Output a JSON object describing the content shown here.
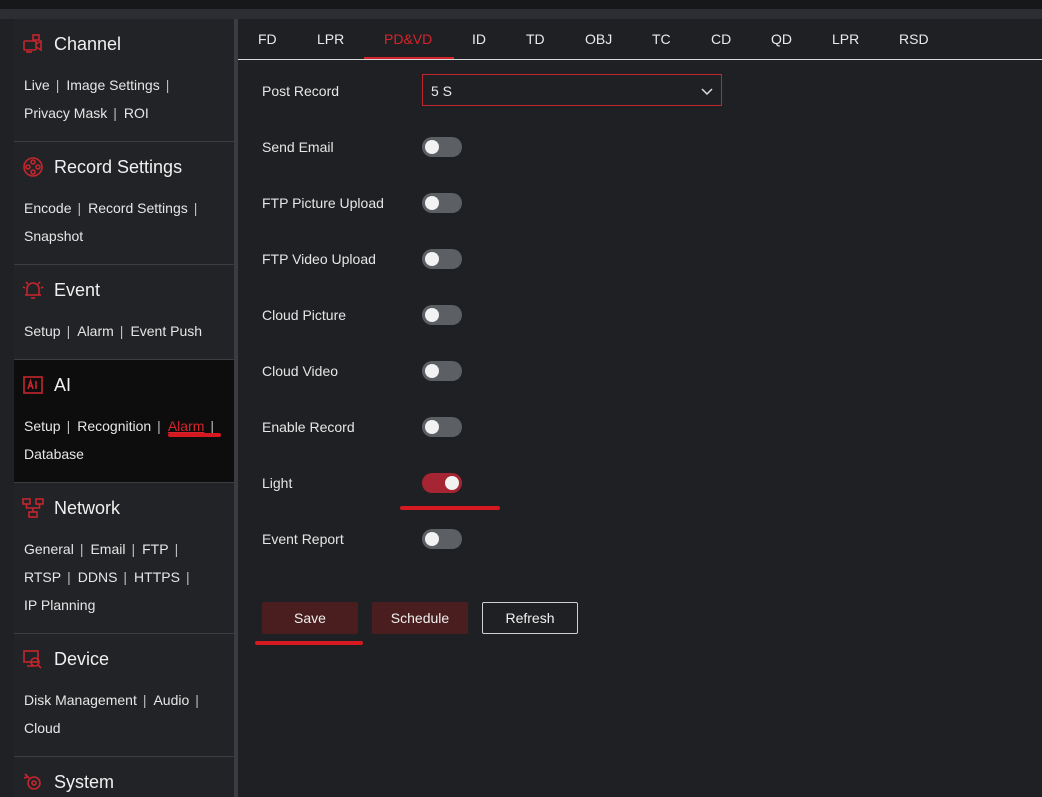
{
  "sidebar": {
    "sections": [
      {
        "title": "Channel",
        "icon": "camera-icon",
        "links": [
          "Live",
          "Image Settings",
          "Privacy Mask",
          "ROI"
        ]
      },
      {
        "title": "Record Settings",
        "icon": "film-reel-icon",
        "links": [
          "Encode",
          "Record Settings",
          "Snapshot"
        ]
      },
      {
        "title": "Event",
        "icon": "alarm-bell-icon",
        "links": [
          "Setup",
          "Alarm",
          "Event Push"
        ]
      },
      {
        "title": "AI",
        "icon": "ai-icon",
        "links": [
          "Setup",
          "Recognition",
          "Alarm",
          "Database"
        ],
        "selected_link": "Alarm"
      },
      {
        "title": "Network",
        "icon": "network-icon",
        "links": [
          "General",
          "Email",
          "FTP",
          "RTSP",
          "DDNS",
          "HTTPS",
          "IP Planning"
        ]
      },
      {
        "title": "Device",
        "icon": "device-icon",
        "links": [
          "Disk Management",
          "Audio",
          "Cloud"
        ]
      },
      {
        "title": "System",
        "icon": "system-gear-icon",
        "links": []
      }
    ]
  },
  "tabs": {
    "items": [
      "FD",
      "LPR",
      "PD&VD",
      "ID",
      "TD",
      "OBJ",
      "TC",
      "CD",
      "QD",
      "LPR",
      "RSD"
    ],
    "selected": "PD&VD"
  },
  "form": {
    "post_record": {
      "label": "Post Record",
      "value": "5 S"
    },
    "toggles": [
      {
        "label": "Send Email",
        "on": false
      },
      {
        "label": "FTP Picture Upload",
        "on": false
      },
      {
        "label": "FTP Video Upload",
        "on": false
      },
      {
        "label": "Cloud Picture",
        "on": false
      },
      {
        "label": "Cloud Video",
        "on": false
      },
      {
        "label": "Enable Record",
        "on": false
      },
      {
        "label": "Light",
        "on": true
      },
      {
        "label": "Event Report",
        "on": false
      }
    ]
  },
  "buttons": {
    "save": "Save",
    "schedule": "Schedule",
    "refresh": "Refresh"
  },
  "colors": {
    "accent": "#d4252c",
    "toggle_on": "#a52532",
    "toggle_off": "#5c5f64",
    "button_fill": "#4a1e1e",
    "annotation": "#d41920"
  }
}
